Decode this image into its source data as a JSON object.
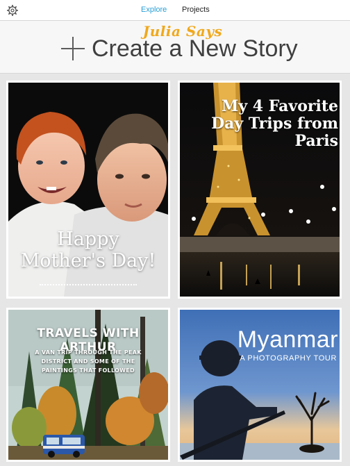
{
  "topbar": {
    "settings_icon": "gear-icon",
    "tabs": [
      {
        "label": "Explore",
        "active": true
      },
      {
        "label": "Projects",
        "active": false
      }
    ],
    "active_color": "#2a9fd6"
  },
  "watermark": {
    "text": "Julia Says",
    "color": "#f0a81c"
  },
  "create": {
    "icon": "plus-icon",
    "label": "Create a New Story"
  },
  "stories": [
    {
      "title": "Happy\nMother's Day!",
      "subtitle": ""
    },
    {
      "title": "My 4 Favorite\nDay Trips from\nParis",
      "subtitle": ""
    },
    {
      "title": "TRAVELS WITH ARTHUR",
      "subtitle": "A VAN TRIP THROUGH THE PEAK DISTRICT AND SOME OF THE PAINTINGS THAT FOLLOWED"
    },
    {
      "title": "Myanmar",
      "subtitle": "A PHOTOGRAPHY TOUR"
    }
  ]
}
